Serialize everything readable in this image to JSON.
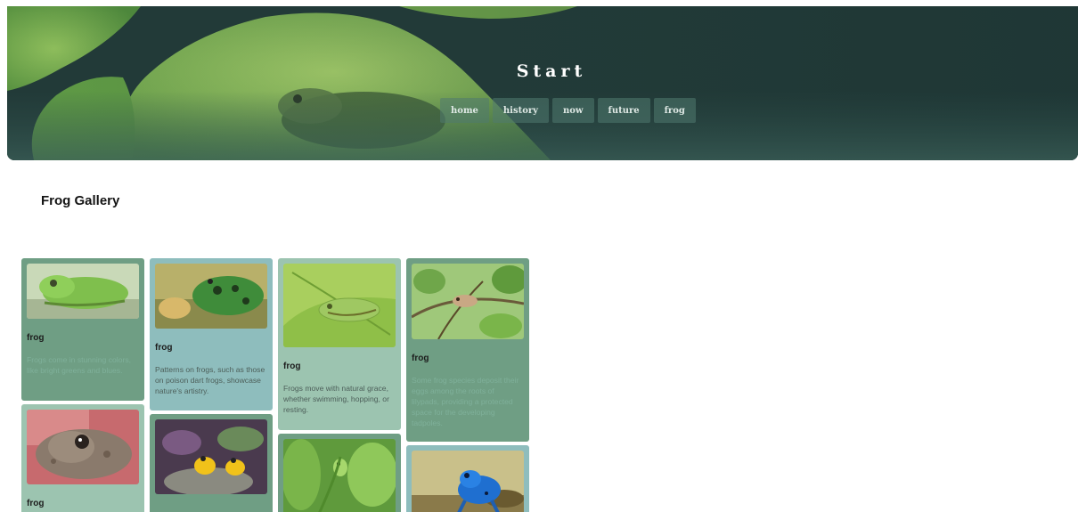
{
  "hero": {
    "title": "Start",
    "nav": [
      "home",
      "history",
      "now",
      "future",
      "frog"
    ]
  },
  "gallery": {
    "title": "Frog Gallery",
    "cards": [
      {
        "title": "frog",
        "text": "Frogs come in stunning colors, like bright greens and blues."
      },
      {
        "title": "frog",
        "text": "Patterns on frogs, such as those on poison dart frogs, showcase nature's artistry."
      },
      {
        "title": "frog",
        "text": "Frogs move with natural grace, whether swimming, hopping, or resting."
      },
      {
        "title": "frog",
        "text": "Some frog species deposit their eggs among the roots of lilypads, providing a protected space for the developing tadpoles."
      },
      {
        "title": "frog",
        "text": ""
      },
      {
        "title": "",
        "text": ""
      },
      {
        "title": "",
        "text": ""
      },
      {
        "title": "",
        "text": ""
      }
    ]
  }
}
